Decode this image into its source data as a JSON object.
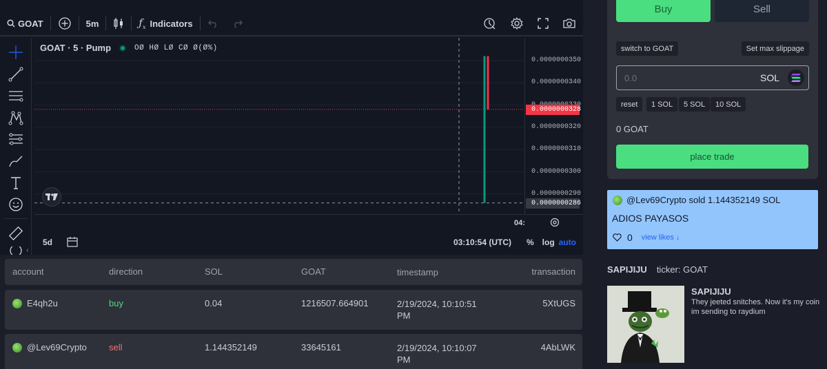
{
  "toolbar": {
    "symbol": "GOAT",
    "interval": "5m",
    "indicators_label": "Indicators"
  },
  "chart": {
    "legend_symbol": "GOAT · 5 · Pump",
    "ohlc": "OØ HØ LØ CØ Ø(Ø%)",
    "time_label": "04:",
    "range": "5d",
    "clock": "03:10:54 (UTC)",
    "percent": "%",
    "log": "log",
    "auto": "auto",
    "colors": {
      "up": "#089981",
      "down": "#f23645",
      "background": "#131722"
    }
  },
  "chart_data": {
    "type": "candlestick",
    "y_ticks": [
      "0.0000000350",
      "0.0000000340",
      "0.0000000330",
      "0.0000000320",
      "0.0000000310",
      "0.0000000300",
      "0.0000000290"
    ],
    "current_price": "0.0000000328",
    "crosshair_price": "0.0000000286",
    "candles": [
      {
        "color": "green",
        "low": 2.86e-08,
        "high": 3.52e-08
      },
      {
        "color": "red",
        "low": 3.28e-08,
        "high": 3.52e-08
      }
    ]
  },
  "trades": {
    "headers": [
      "account",
      "direction",
      "SOL",
      "GOAT",
      "timestamp",
      "transaction"
    ],
    "rows": [
      {
        "account": "E4qh2u",
        "direction": "buy",
        "sol": "0.04",
        "goat": "1216507.664901",
        "timestamp": "2/19/2024, 10:10:51 PM",
        "tx": "5XtUGS"
      },
      {
        "account": "@Lev69Crypto",
        "direction": "sell",
        "sol": "1.144352149",
        "goat": "33645161",
        "timestamp": "2/19/2024, 10:10:07 PM",
        "tx": "4AbLWK"
      }
    ]
  },
  "panel": {
    "buy": "Buy",
    "sell": "Sell",
    "switch": "switch to GOAT",
    "slippage": "Set max slippage",
    "amount_placeholder": "0.0",
    "currency": "SOL",
    "quick": [
      "reset",
      "1 SOL",
      "5 SOL",
      "10 SOL"
    ],
    "balance": "0 GOAT",
    "place": "place trade"
  },
  "reply": {
    "header": "@Lev69Crypto sold 1.144352149 SOL",
    "message": "ADIOS PAYASOS",
    "likes": "0",
    "view_likes": "view likes ↓"
  },
  "token": {
    "name": "SAPIJIJU",
    "ticker": "ticker: GOAT",
    "title": "SAPIJIJU",
    "description": "They jeeted snitches. Now it's my coin im sending to raydium"
  }
}
